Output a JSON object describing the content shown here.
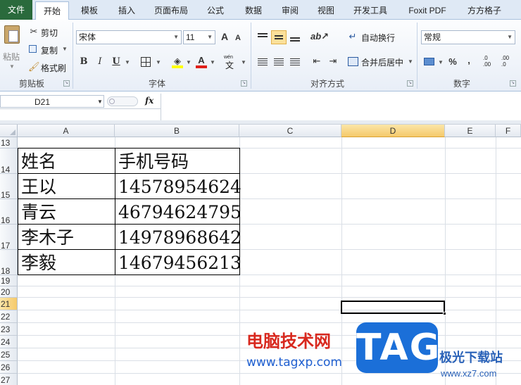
{
  "ribbon_tabs": [
    "文件",
    "开始",
    "模板",
    "插入",
    "页面布局",
    "公式",
    "数据",
    "审阅",
    "视图",
    "开发工具",
    "Foxit PDF",
    "方方格子"
  ],
  "active_tab_index": 1,
  "colors": {
    "file_tab": "#2a6a3c",
    "tabbar": "#dfe9f5",
    "selected_header": "#f5c96a",
    "watermark_red": "#d8281e",
    "watermark_blue": "#1b6fd8"
  },
  "clipboard": {
    "paste": "粘贴",
    "cut": "剪切",
    "copy": "复制",
    "format_painter": "格式刷",
    "group": "剪贴板"
  },
  "font": {
    "name": "宋体",
    "size": "11",
    "group": "字体",
    "bold": "B",
    "italic": "I",
    "underline": "U",
    "grow": "A",
    "shrink": "A",
    "wen": "wén"
  },
  "alignment": {
    "wrap": "自动换行",
    "merge": "合并后居中",
    "group": "对齐方式"
  },
  "number": {
    "format": "常规",
    "percent": "%",
    "comma": ",",
    "inc_decimal": ".00",
    "dec_decimal": ".0",
    "group": "数字"
  },
  "formula_bar": {
    "name_box": "D21",
    "fx": "fx",
    "value": ""
  },
  "columns": [
    "A",
    "B",
    "C",
    "D",
    "E",
    "F"
  ],
  "selected_column": "D",
  "rows": [
    "13",
    "14",
    "15",
    "16",
    "17",
    "18",
    "19",
    "20",
    "21",
    "22",
    "23",
    "24",
    "25",
    "26",
    "27"
  ],
  "selected_row": "21",
  "table": [
    [
      "姓名",
      "手机号码"
    ],
    [
      "王以",
      "14578954624"
    ],
    [
      "青云",
      "46794624795"
    ],
    [
      "李木子",
      "14978968642"
    ],
    [
      "李毅",
      "14679456213"
    ]
  ],
  "watermark": {
    "cn": "电脑技术网",
    "url": "www.tagxp.com",
    "tag": "TAG",
    "site_cn": "极光下载站",
    "site_url": "www.xz7.com"
  }
}
